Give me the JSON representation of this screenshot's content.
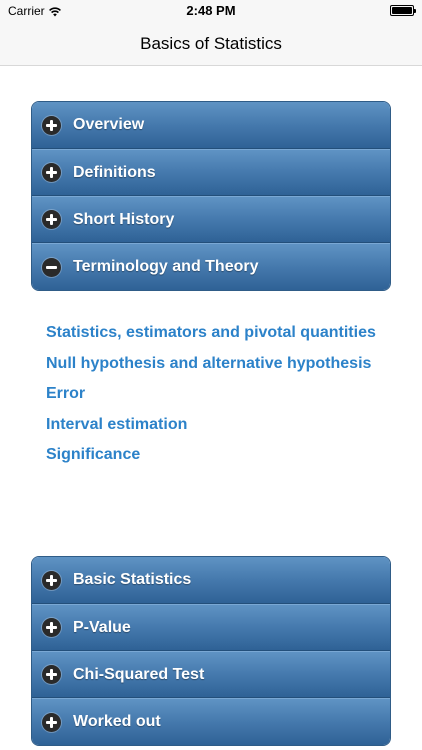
{
  "status_bar": {
    "carrier": "Carrier",
    "time": "2:48 PM",
    "battery_level": 1.0,
    "icons": [
      "wifi-icon",
      "battery-icon"
    ]
  },
  "nav": {
    "title": "Basics of Statistics"
  },
  "sections_top": [
    {
      "label": "Overview",
      "state": "collapsed",
      "icon": "plus-circle-icon"
    },
    {
      "label": "Definitions",
      "state": "collapsed",
      "icon": "plus-circle-icon"
    },
    {
      "label": "Short History",
      "state": "collapsed",
      "icon": "plus-circle-icon"
    },
    {
      "label": "Terminology and Theory",
      "state": "expanded",
      "icon": "minus-circle-icon"
    }
  ],
  "expanded_section": {
    "links": [
      "Statistics, estimators and pivotal quantities",
      "Null hypothesis and alternative hypothesis",
      "Error",
      "Interval estimation",
      "Significance"
    ]
  },
  "sections_bottom": [
    {
      "label": "Basic Statistics",
      "state": "collapsed",
      "icon": "plus-circle-icon"
    },
    {
      "label": "P-Value",
      "state": "collapsed",
      "icon": "plus-circle-icon"
    },
    {
      "label": "Chi-Squared Test",
      "state": "collapsed",
      "icon": "plus-circle-icon"
    },
    {
      "label": "Worked out",
      "state": "collapsed",
      "icon": "plus-circle-icon"
    }
  ],
  "colors": {
    "accordion_header": "#4579ad",
    "link_text": "#2c82c9",
    "nav_background": "#f7f7f7"
  }
}
